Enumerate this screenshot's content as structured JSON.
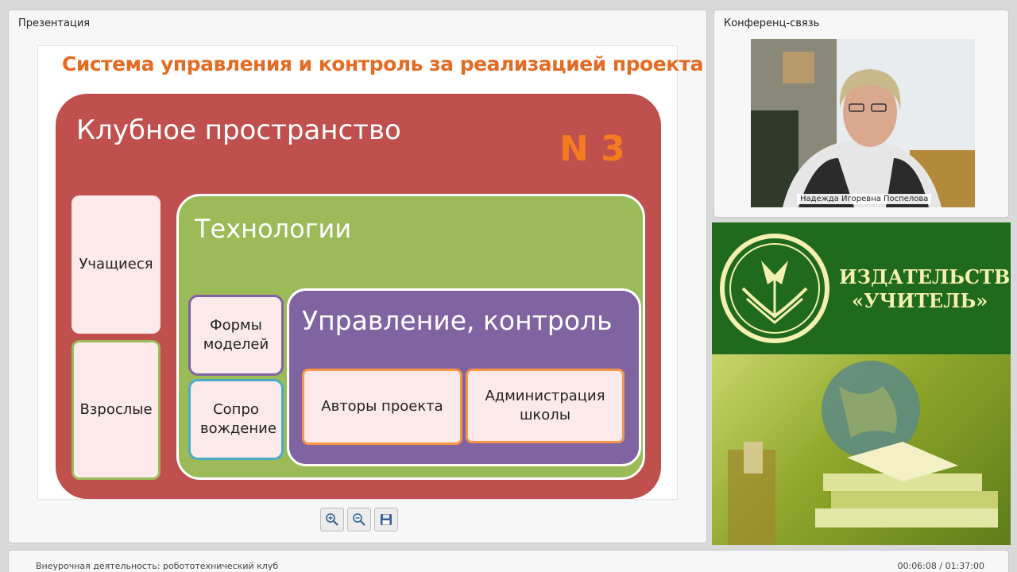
{
  "presentation": {
    "panel_title": "Презентация",
    "slide": {
      "title": "Система управления и контроль за реализацией проекта",
      "club": {
        "label": "Клубное пространство",
        "number": "N 3",
        "participants": [
          "Учащиеся",
          "Взрослые"
        ],
        "technologies": {
          "label": "Технологии",
          "items": [
            "Формы моделей",
            "Сопро вождение"
          ],
          "management": {
            "label": "Управление, контроль",
            "items": [
              "Авторы проекта",
              "Администрация школы"
            ]
          }
        }
      }
    },
    "toolbar": {
      "zoom_in_icon": "zoom-in-icon",
      "zoom_out_icon": "zoom-out-icon",
      "save_icon": "floppy-disk-icon"
    }
  },
  "conference": {
    "panel_title": "Конференц-связь",
    "speaker_name": "Надежда Игоревна Поспелова"
  },
  "ad": {
    "line1": "ИЗДАТЕЛЬСТВО",
    "line2": "«УЧИТЕЛЬ»"
  },
  "footer": {
    "course_title": "Внеурочная деятельность: робототехнический клуб",
    "time": "00:06:08 / 01:37:00"
  }
}
